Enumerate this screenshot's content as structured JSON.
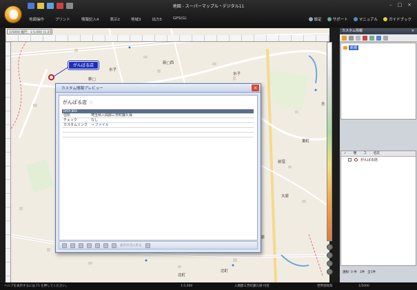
{
  "window": {
    "title": "地図 - スーパーマップル・デジタル11",
    "controls": [
      "–",
      "□",
      "×"
    ]
  },
  "ribbon": {
    "tabs": [
      "地図操作",
      "プリント",
      "情報記入4",
      "表示2",
      "地域3",
      "出力5",
      "GPS(G)"
    ],
    "help_links": [
      "設定",
      "サポート",
      "マニュアル",
      "ガイドブック"
    ]
  },
  "map": {
    "scale_label": "1/5000 縮尺：1:5,000 (1:2500)",
    "pin_label": "がんばる店",
    "labels": [
      "水子",
      "新□西",
      "水子",
      "幹□",
      "前窪",
      "大原",
      "北町",
      "大原",
      "志",
      "北町",
      "東町"
    ]
  },
  "dialog": {
    "title": "カスタム情報プレビュー",
    "item_name": "がんばる店",
    "star": "☆",
    "table_header": "DATA BOX",
    "rows": [
      {
        "key": "住所",
        "value": "埼玉県入間郡三芳町藤久保"
      },
      {
        "key": "チェック",
        "value": "なし"
      },
      {
        "key": "カスタムリンク",
        "value": "→ ファイル"
      }
    ],
    "toolbar_label": "表示の元に戻る"
  },
  "right_panel": {
    "title": "カスタム情報",
    "tree_item": "新規",
    "list_headers": [
      "✓",
      "種",
      "コ",
      "名前"
    ],
    "list_item": "がんばる店",
    "bottom": [
      "選択: 0 件",
      "1件",
      "全1件"
    ]
  },
  "statusbar": {
    "left": "ヘルプを表示するには F1 を押してください。",
    "mid1": "1:5,000",
    "mid2": "入間郡三芳町藤久保 付近",
    "mid3": "世界測地系",
    "right": "1/5000"
  },
  "colors": {
    "pin_tag": "#1d2fb8",
    "pin_ring": "#c2151b",
    "dialog_bg": "#dfe6f2",
    "map_bg": "#f1ece2"
  }
}
